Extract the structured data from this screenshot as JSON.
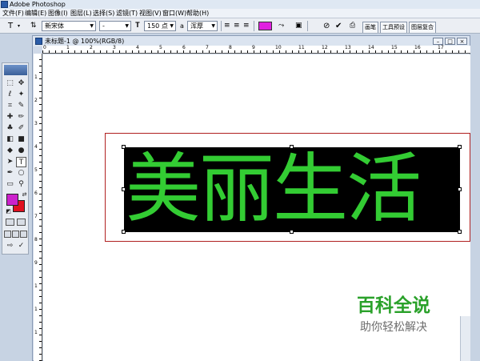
{
  "app": {
    "title": "Adobe Photoshop"
  },
  "menu": [
    "文件(F)",
    "编辑(E)",
    "图像(I)",
    "图层(L)",
    "选择(S)",
    "滤镜(T)",
    "视图(V)",
    "窗口(W)",
    "帮助(H)"
  ],
  "options": {
    "tool_glyph": "T",
    "font_family": "新宋体",
    "font_style": "-",
    "font_size": "150 点",
    "aa_label": "a",
    "anti_alias": "浑厚",
    "text_color": "#e020e0",
    "palette_tabs": [
      "画笔",
      "工具预设",
      "图层复合"
    ]
  },
  "document": {
    "title": "未标题-1 @ 100%(RGB/8)",
    "ruler_top": [
      "0",
      "1",
      "2",
      "3",
      "4",
      "5",
      "6",
      "7",
      "8",
      "9",
      "10",
      "11",
      "12",
      "13",
      "14",
      "15",
      "16",
      "17"
    ],
    "ruler_left": [
      "1",
      "2",
      "3",
      "4",
      "5",
      "6",
      "7",
      "8",
      "9",
      "1",
      "1",
      "1"
    ],
    "text_layer": "美丽生活",
    "text_fill": "#33cc33",
    "text_background": "#000000",
    "frame_color": "#b02020"
  },
  "toolbox": {
    "foreground": "#cc22cc",
    "background": "#e01020"
  },
  "watermark": {
    "brand": "百科全说",
    "slogan": "助你轻松解决"
  }
}
